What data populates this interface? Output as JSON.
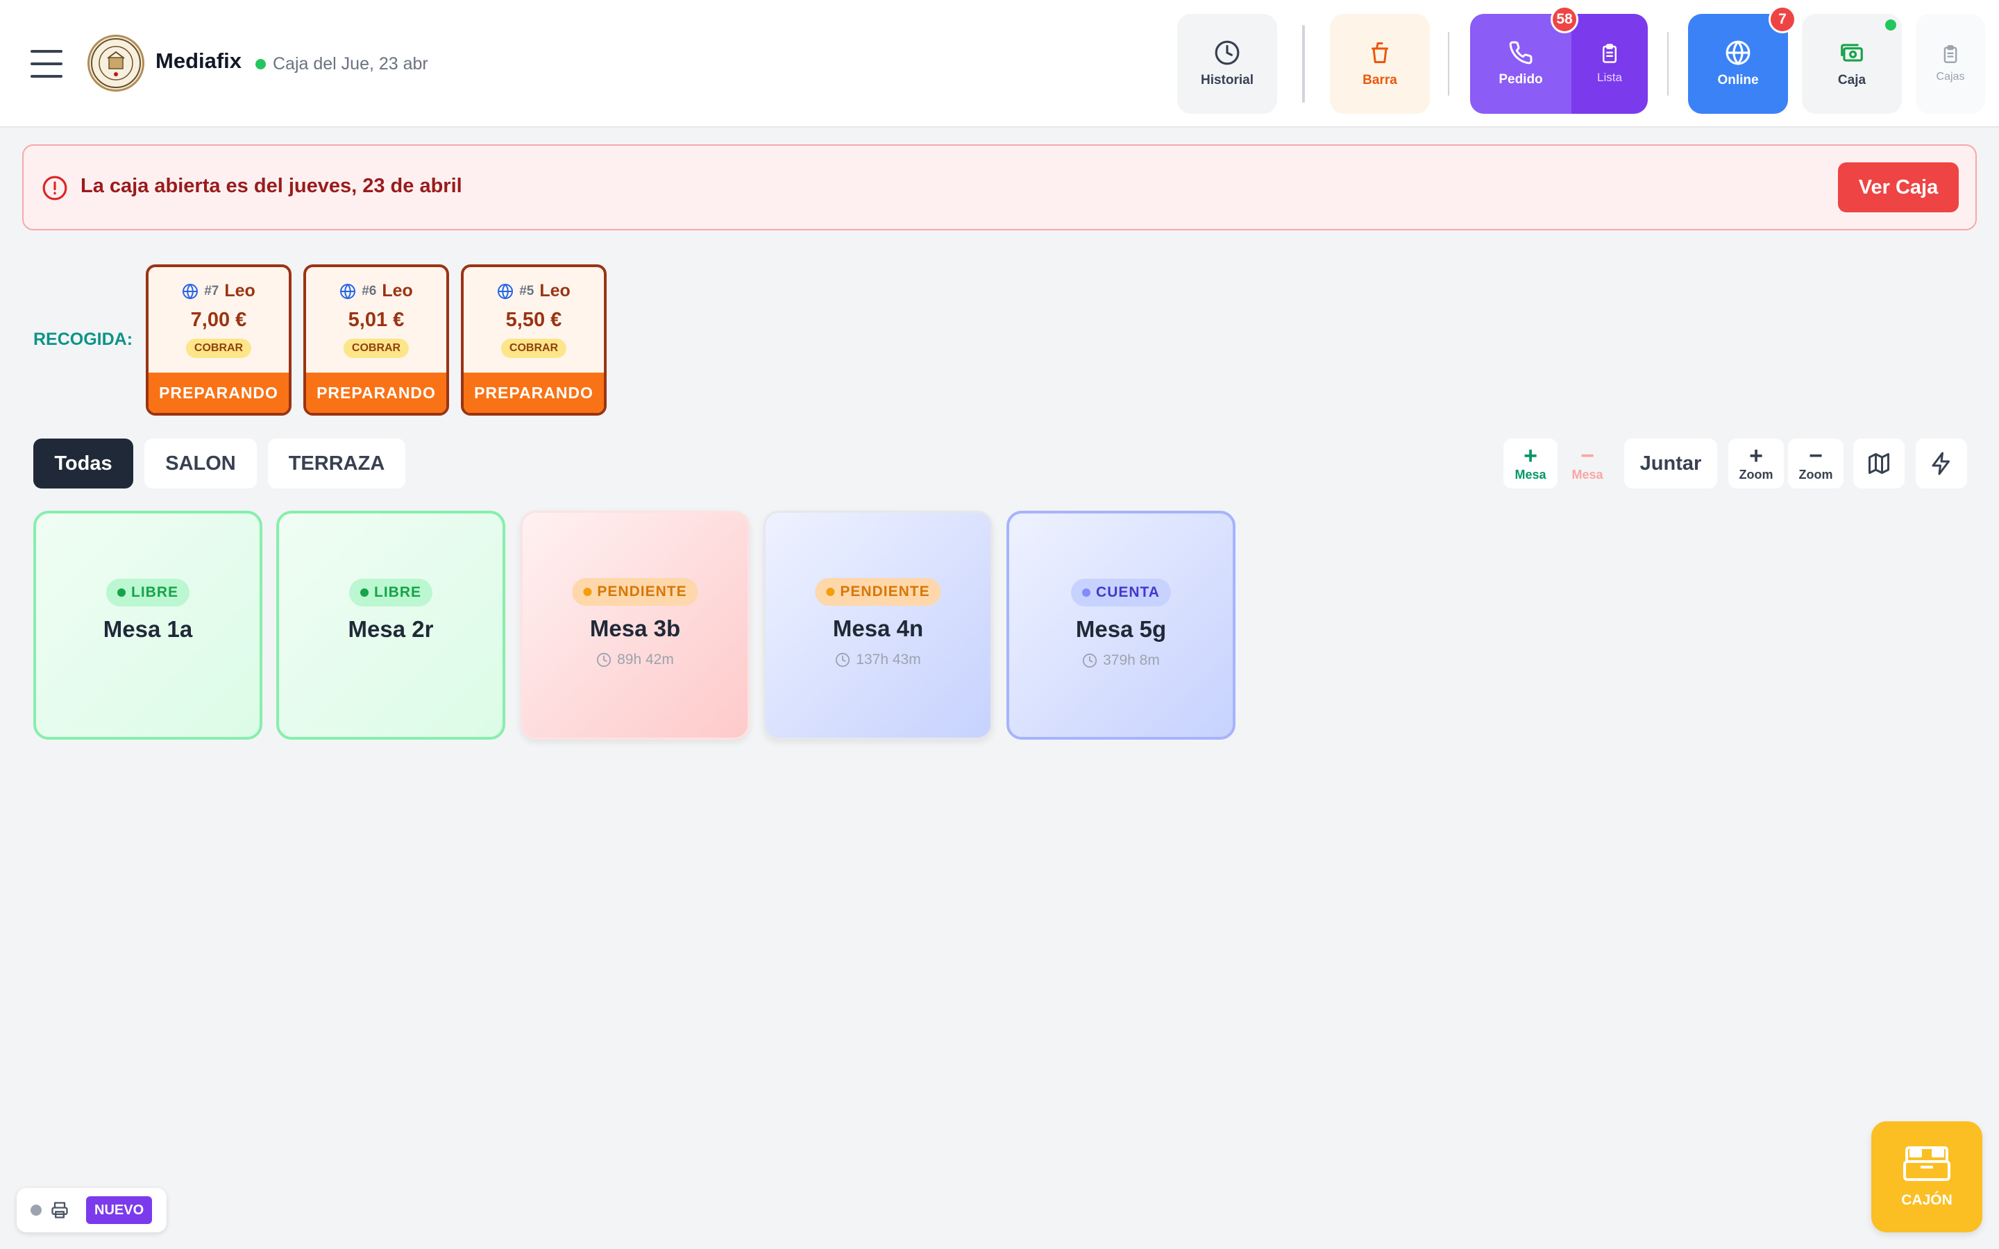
{
  "header": {
    "brand": "Mediafix",
    "caja_info": "Caja del Jue, 23 abr",
    "logo_text": "EL RINCONCITO",
    "buttons": {
      "historial": "Historial",
      "barra": "Barra",
      "pedido": "Pedido",
      "pedido_badge": "58",
      "lista": "Lista",
      "online": "Online",
      "online_badge": "7",
      "caja": "Caja",
      "cajas": "Cajas"
    }
  },
  "alert": {
    "message": "La caja abierta es del jueves, 23 de abril",
    "action": "Ver Caja"
  },
  "recogida": {
    "label": "RECOGIDA:",
    "orders": [
      {
        "num": "#7",
        "name": "Leo",
        "price": "7,00 €",
        "tag": "COBRAR",
        "status": "PREPARANDO"
      },
      {
        "num": "#6",
        "name": "Leo",
        "price": "5,01 €",
        "tag": "COBRAR",
        "status": "PREPARANDO"
      },
      {
        "num": "#5",
        "name": "Leo",
        "price": "5,50 €",
        "tag": "COBRAR",
        "status": "PREPARANDO"
      }
    ]
  },
  "tabs": [
    "Todas",
    "SALON",
    "TERRAZA"
  ],
  "tools": {
    "add_mesa": "Mesa",
    "remove_mesa": "Mesa",
    "juntar": "Juntar",
    "zoom_in": "Zoom",
    "zoom_out": "Zoom"
  },
  "mesas": [
    {
      "name": "Mesa 1a",
      "status": "LIBRE",
      "time": ""
    },
    {
      "name": "Mesa 2r",
      "status": "LIBRE",
      "time": ""
    },
    {
      "name": "Mesa 3b",
      "status": "PENDIENTE",
      "time": "89h 42m"
    },
    {
      "name": "Mesa 4n",
      "status": "PENDIENTE",
      "time": "137h 43m"
    },
    {
      "name": "Mesa 5g",
      "status": "CUENTA",
      "time": "379h 8m"
    }
  ],
  "bottom": {
    "nuevo": "NUEVO",
    "cajon": "CAJÓN"
  },
  "colors": {
    "accent_purple": "#7c3aed",
    "accent_blue": "#3b82f6",
    "alert_red": "#ef4444",
    "order_orange": "#f97316",
    "libre_green": "#16a34a",
    "pendiente_amber": "#d97706",
    "cuenta_indigo": "#4338ca",
    "cajon_yellow": "#fbbf24"
  }
}
